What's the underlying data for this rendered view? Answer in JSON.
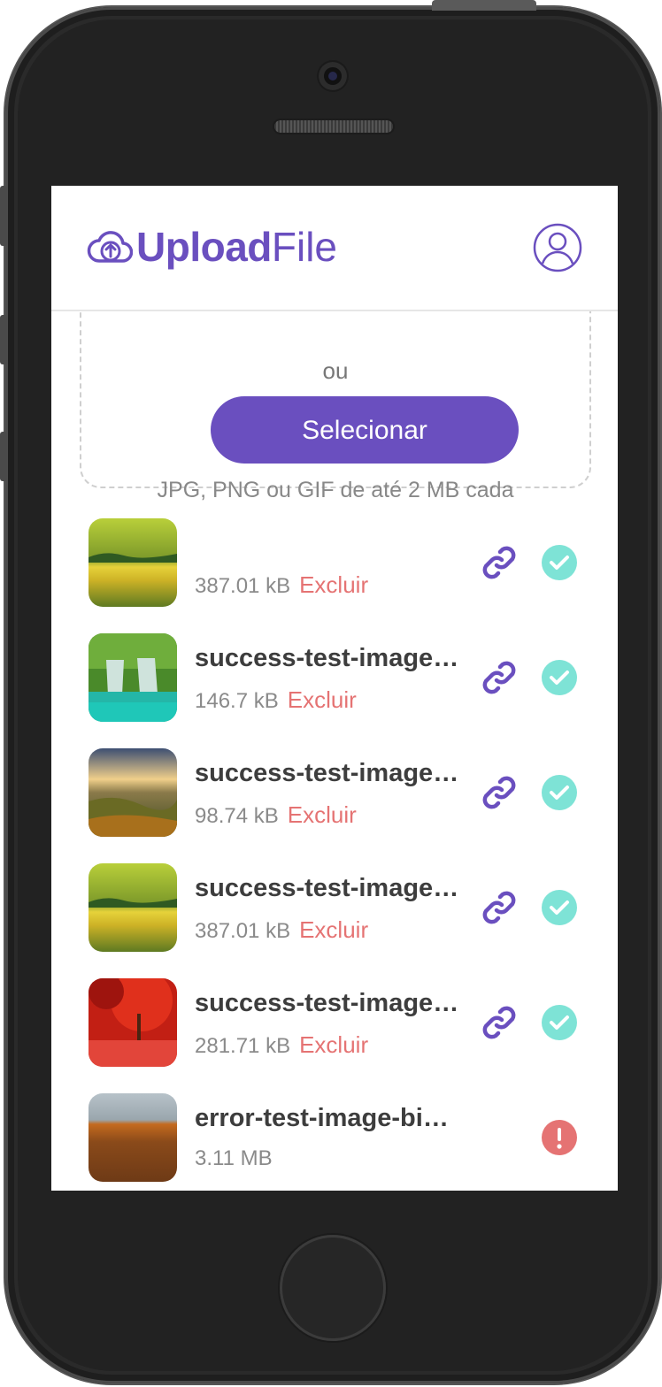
{
  "app": {
    "logo_strong": "Upload",
    "logo_light": "File",
    "brand_color": "#6a4fbf"
  },
  "dropzone": {
    "or_text": "ou",
    "select_label": "Selecionar",
    "hint": "JPG, PNG ou GIF de até 2 MB cada"
  },
  "colors": {
    "success": "#7ee3d6",
    "error": "#e57373",
    "link": "#6a4fbf"
  },
  "files": [
    {
      "name": "",
      "size": "387.01 kB",
      "delete_label": "Excluir",
      "status": "success",
      "thumb": "meadow"
    },
    {
      "name": "success-test-image.jpg",
      "size": "146.7 kB",
      "delete_label": "Excluir",
      "status": "success",
      "thumb": "waterfall"
    },
    {
      "name": "success-test-image.jpg",
      "size": "98.74 kB",
      "delete_label": "Excluir",
      "status": "success",
      "thumb": "sunset"
    },
    {
      "name": "success-test-image.jpg",
      "size": "387.01 kB",
      "delete_label": "Excluir",
      "status": "success",
      "thumb": "meadow"
    },
    {
      "name": "success-test-image.jpg",
      "size": "281.71 kB",
      "delete_label": "Excluir",
      "status": "success",
      "thumb": "red-trees"
    },
    {
      "name": "error-test-image-big.jpg",
      "size": "3.11 MB",
      "delete_label": "",
      "status": "error",
      "thumb": "field"
    }
  ]
}
